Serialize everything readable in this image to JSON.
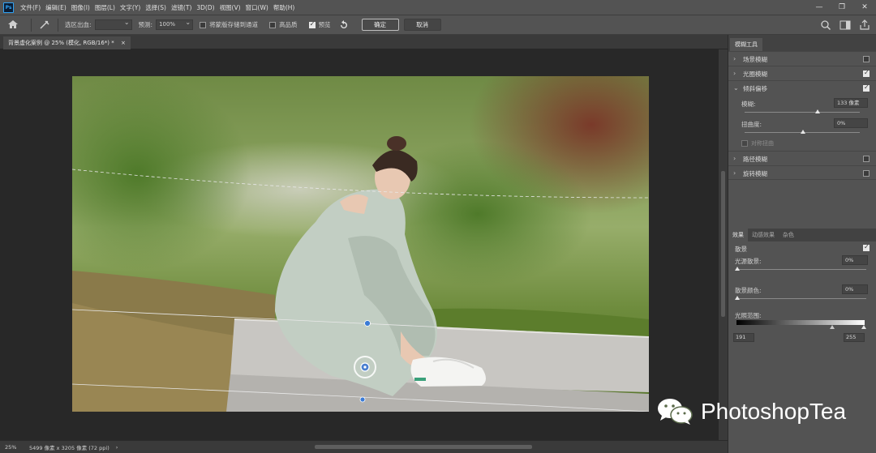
{
  "app": {
    "logo_text": "Ps"
  },
  "menu": [
    "文件(F)",
    "编辑(E)",
    "图像(I)",
    "图层(L)",
    "文字(Y)",
    "选择(S)",
    "滤镜(T)",
    "3D(D)",
    "视图(V)",
    "窗口(W)",
    "帮助(H)"
  ],
  "window_controls": {
    "minimize": "—",
    "maximize": "❐",
    "close": "✕"
  },
  "options": {
    "selection_bleed_label": "选区出血:",
    "selection_bleed_value": "",
    "preview_label": "预测:",
    "preview_value": "100%",
    "save_mask_label": "将蒙版存储到通道",
    "save_mask_checked": false,
    "high_quality_label": "高品质",
    "high_quality_checked": false,
    "preview_check_label": "预览",
    "preview_checked": true,
    "ok_label": "确定",
    "cancel_label": "取消"
  },
  "document": {
    "tab_title": "背景虚化案例 @ 25% (模化, RGB/16*) *",
    "close": "×"
  },
  "status": {
    "zoom": "25%",
    "info": "5499 像素 x 3205 像素 (72 ppi)",
    "arrow": "›"
  },
  "panel": {
    "title": "模糊工具",
    "rows": [
      {
        "label": "场景模糊",
        "checked": false,
        "expanded": false
      },
      {
        "label": "光圈模糊",
        "checked": true,
        "expanded": false
      },
      {
        "label": "倾斜偏移",
        "checked": true,
        "expanded": true
      }
    ],
    "tilt": {
      "blur_label": "模糊:",
      "blur_value": "133 像素",
      "blur_level": 0.63,
      "distortion_label": "扭曲度:",
      "distortion_value": "0%",
      "distortion_level": 0.5,
      "symmetric_label": "对称扭曲"
    },
    "rows_after": [
      {
        "label": "路径模糊",
        "checked": false
      },
      {
        "label": "旋转模糊",
        "checked": false
      }
    ],
    "fx_tabs": [
      "效果",
      "动感效果",
      "杂色"
    ],
    "bokeh_label": "散景",
    "bokeh_checked": true,
    "light_bokeh_label": "光源散景:",
    "light_bokeh_value": "0%",
    "bokeh_color_label": "散景颜色:",
    "bokeh_color_value": "0%",
    "light_range_label": "光照范围:",
    "light_range_min": "191",
    "light_range_max": "255"
  },
  "watermark": {
    "text": "PhotoshopTea"
  },
  "colors": {
    "chrome": "#535353",
    "canvas_bg": "#282828",
    "accent": "#2fa3f5"
  }
}
